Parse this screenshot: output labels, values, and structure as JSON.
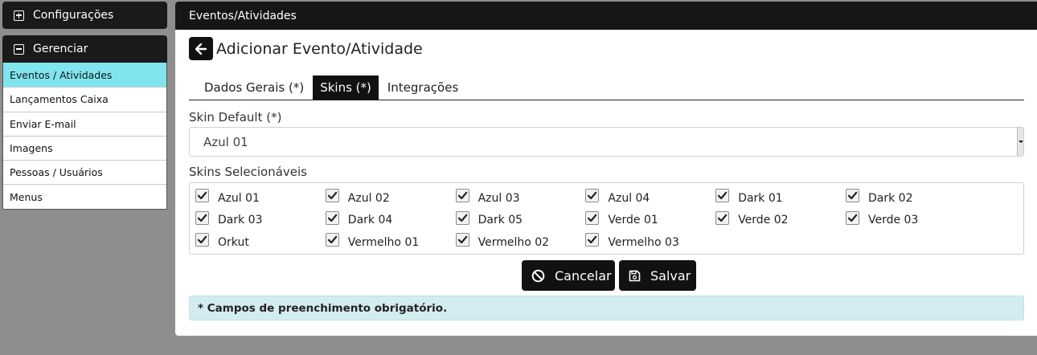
{
  "sidebar": {
    "configuracoes": "Configurações",
    "gerenciar": "Gerenciar",
    "items": [
      "Eventos / Atividades",
      "Lançamentos Caixa",
      "Enviar E-mail",
      "Imagens",
      "Pessoas / Usuários",
      "Menus"
    ]
  },
  "main": {
    "header": "Eventos/Atividades",
    "title": "Adicionar Evento/Atividade",
    "tabs": [
      "Dados Gerais (*)",
      "Skins (*)",
      "Integrações"
    ],
    "skin_default_label": "Skin Default (*)",
    "skin_default_value": "Azul 01",
    "skins_label": "Skins Selecionáveis",
    "skins": [
      "Azul 01",
      "Azul 02",
      "Azul 03",
      "Azul 04",
      "Dark 01",
      "Dark 02",
      "Dark 03",
      "Dark 04",
      "Dark 05",
      "Verde 01",
      "Verde 02",
      "Verde 03",
      "Orkut",
      "Vermelho 01",
      "Vermelho 02",
      "Vermelho 03"
    ],
    "cancel": "Cancelar",
    "save": "Salvar",
    "required_note": "* Campos de preenchimento obrigatório."
  }
}
